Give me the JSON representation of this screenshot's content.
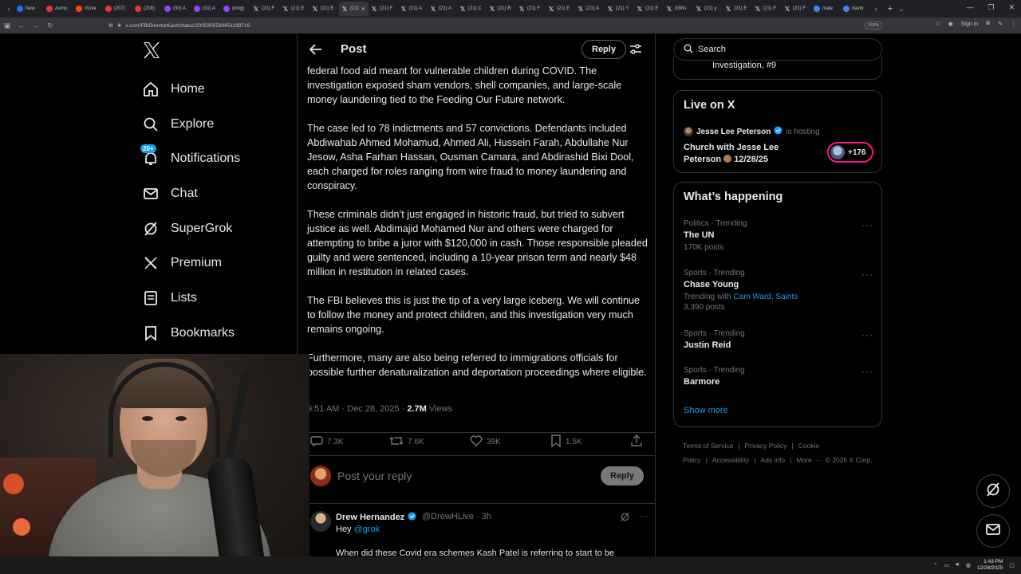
{
  "browser": {
    "tabs": [
      {
        "label": "New",
        "fav": "#1a73e8"
      },
      {
        "label": "Asmo",
        "fav": "#e53935"
      },
      {
        "label": "r/Live",
        "fav": "#ff4500"
      },
      {
        "label": "(207)",
        "fav": "#e53935"
      },
      {
        "label": "(208)",
        "fav": "#e53935"
      },
      {
        "label": "(30) A",
        "fav": "#9146ff"
      },
      {
        "label": "(31) A",
        "fav": "#9146ff"
      },
      {
        "label": "(long)",
        "fav": "#9146ff"
      },
      {
        "label": "(21) F",
        "fav": "x"
      },
      {
        "label": "(21) E",
        "fav": "x"
      },
      {
        "label": "(21) E",
        "fav": "x"
      },
      {
        "label": "(21)",
        "fav": "x",
        "active": true
      },
      {
        "label": "(21) F",
        "fav": "x"
      },
      {
        "label": "(21) A",
        "fav": "x"
      },
      {
        "label": "(21) A",
        "fav": "x"
      },
      {
        "label": "(21) C",
        "fav": "x"
      },
      {
        "label": "(21) R",
        "fav": "x"
      },
      {
        "label": "(21) F",
        "fav": "x"
      },
      {
        "label": "(21) E",
        "fav": "x"
      },
      {
        "label": "(21) A",
        "fav": "x"
      },
      {
        "label": "(21) Y",
        "fav": "x"
      },
      {
        "label": "(21) E",
        "fav": "x"
      },
      {
        "label": "G9N\\",
        "fav": "x"
      },
      {
        "label": "(21) y",
        "fav": "x"
      },
      {
        "label": "(21) E",
        "fav": "x"
      },
      {
        "label": "(21) F",
        "fav": "x"
      },
      {
        "label": "(21) F",
        "fav": "x"
      },
      {
        "label": "male",
        "fav": "#4285f4"
      },
      {
        "label": "david",
        "fav": "#4285f4"
      }
    ],
    "url": "x.com/FBIDirectorKash/status/2005305530651189719",
    "zoom": "150%",
    "sign_in": "Sign in"
  },
  "nav": {
    "items": [
      {
        "label": "Home",
        "icon": "home-icon"
      },
      {
        "label": "Explore",
        "icon": "search-icon"
      },
      {
        "label": "Notifications",
        "icon": "bell-icon",
        "badge": "20+"
      },
      {
        "label": "Chat",
        "icon": "mail-icon"
      },
      {
        "label": "SuperGrok",
        "icon": "grok-icon"
      },
      {
        "label": "Premium",
        "icon": "x-logo-icon"
      },
      {
        "label": "Lists",
        "icon": "list-icon"
      },
      {
        "label": "Bookmarks",
        "icon": "bookmark-icon"
      }
    ]
  },
  "post": {
    "header_title": "Post",
    "reply_button": "Reply",
    "paragraphs": [
      "federal food aid meant for vulnerable children during COVID. The investigation exposed sham vendors, shell companies, and large-scale money laundering tied to the Feeding Our Future network.",
      "The case led to 78 indictments and 57 convictions. Defendants included Abdiwahab Ahmed Mohamud, Ahmed Ali, Hussein Farah, Abdullahe Nur Jesow, Asha Farhan Hassan, Ousman Camara, and Abdirashid Bixi Dool, each charged for roles ranging from wire fraud to money laundering and conspiracy.",
      "These criminals didn’t just engaged in historic fraud, but tried to subvert justice as well. Abdimajid Mohamed Nur and others were charged for attempting to bribe a juror with $120,000 in cash. Those responsible pleaded guilty and were sentenced, including a 10-year prison term and nearly $48 million in restitution in related cases.",
      "The FBI believes this is just the tip of a very large iceberg. We will continue to follow the money and protect children, and this investigation very much remains ongoing.",
      "Furthermore, many are also being referred to immigrations officials for possible further denaturalization and deportation proceedings where eligible."
    ],
    "time": "9:51 AM · Dec 28, 2025 · ",
    "views_count": "2.7M",
    "views_label": " Views",
    "replies": "7.3K",
    "reposts": "7.6K",
    "likes": "39K",
    "bookmarks": "1.5K"
  },
  "composer": {
    "placeholder": "Post your reply",
    "button": "Reply"
  },
  "reply": {
    "name": "Drew Hernandez",
    "handle": "@DrewHLive · 3h",
    "text_prefix": "Hey ",
    "mention": "@grok",
    "line2": "When did these Covid era schemes Kash Patel is referring to start to be"
  },
  "sidebar": {
    "search_placeholder": "Search",
    "top_card_text": "Investigation, #9",
    "live_title": "Live on X",
    "live_host": "Jesse Lee Peterson",
    "live_hosting": "is hosting",
    "live_event_line1": "Church with Jesse Lee",
    "live_event_line2": "Peterson",
    "live_event_date": "12/28/25",
    "live_count": "+176",
    "happening_title": "What’s happening",
    "trends": [
      {
        "category": "Politics · Trending",
        "name": "The UN",
        "sub": "170K posts"
      },
      {
        "category": "Sports · Trending",
        "name": "Chase Young",
        "sub_prefix": "Trending with ",
        "sub_links": "Cam Ward, Saints",
        "sub2": "3,390 posts"
      },
      {
        "category": "Sports · Trending",
        "name": "Justin Reid"
      },
      {
        "category": "Sports · Trending",
        "name": "Barmore"
      }
    ],
    "show_more": "Show more",
    "footer": [
      "Terms of Service",
      "|",
      "Privacy Policy",
      "|",
      "Cookie Policy",
      "|",
      "Accessibility",
      "|",
      "Ads info",
      "|",
      "More ···",
      "© 2025 X Corp."
    ]
  },
  "taskbar": {
    "time": "1:43 PM",
    "date": "12/28/2025"
  },
  "colors": {
    "accent": "#1d9bf0",
    "live_ring": "#f91880"
  }
}
